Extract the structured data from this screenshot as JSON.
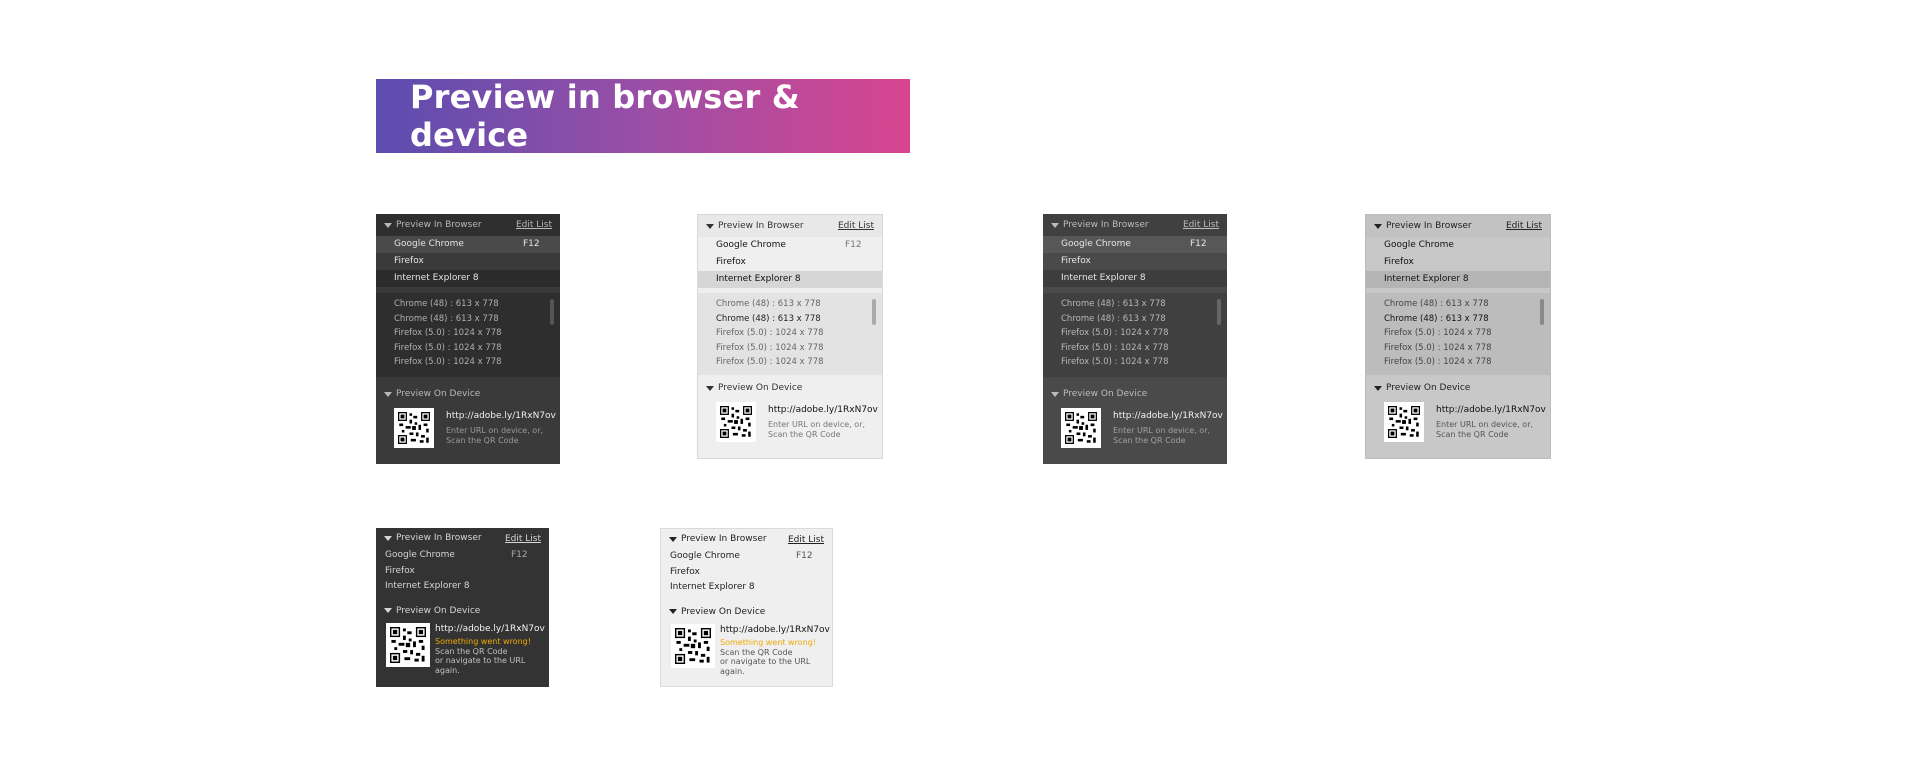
{
  "banner": {
    "title": "Preview in browser & device"
  },
  "panel": {
    "browser_header": "Preview In Browser",
    "edit_list": "Edit List",
    "browsers": [
      {
        "label": "Google Chrome",
        "shortcut": "F12"
      },
      {
        "label": "Firefox",
        "shortcut": ""
      },
      {
        "label": "Internet Explorer 8",
        "shortcut": ""
      }
    ],
    "history": [
      "Chrome (48) : 613 x 778",
      "Chrome (48) : 613 x 778",
      "Firefox (5.0) : 1024 x 778",
      "Firefox (5.0) : 1024 x 778",
      "Firefox (5.0) : 1024 x 778"
    ],
    "device_header": "Preview On Device",
    "url": "http://adobe.ly/1RxN7ov",
    "hint_line1": "Enter URL on device, or,",
    "hint_line2": "Scan the QR Code",
    "error": "Something went wrong!",
    "error_line1": "Scan the QR Code",
    "error_line2": "or navigate to the URL again."
  },
  "colors": {
    "error": "#f2a900",
    "banner_start": "#5b4db0",
    "banner_end": "#d8458f"
  }
}
